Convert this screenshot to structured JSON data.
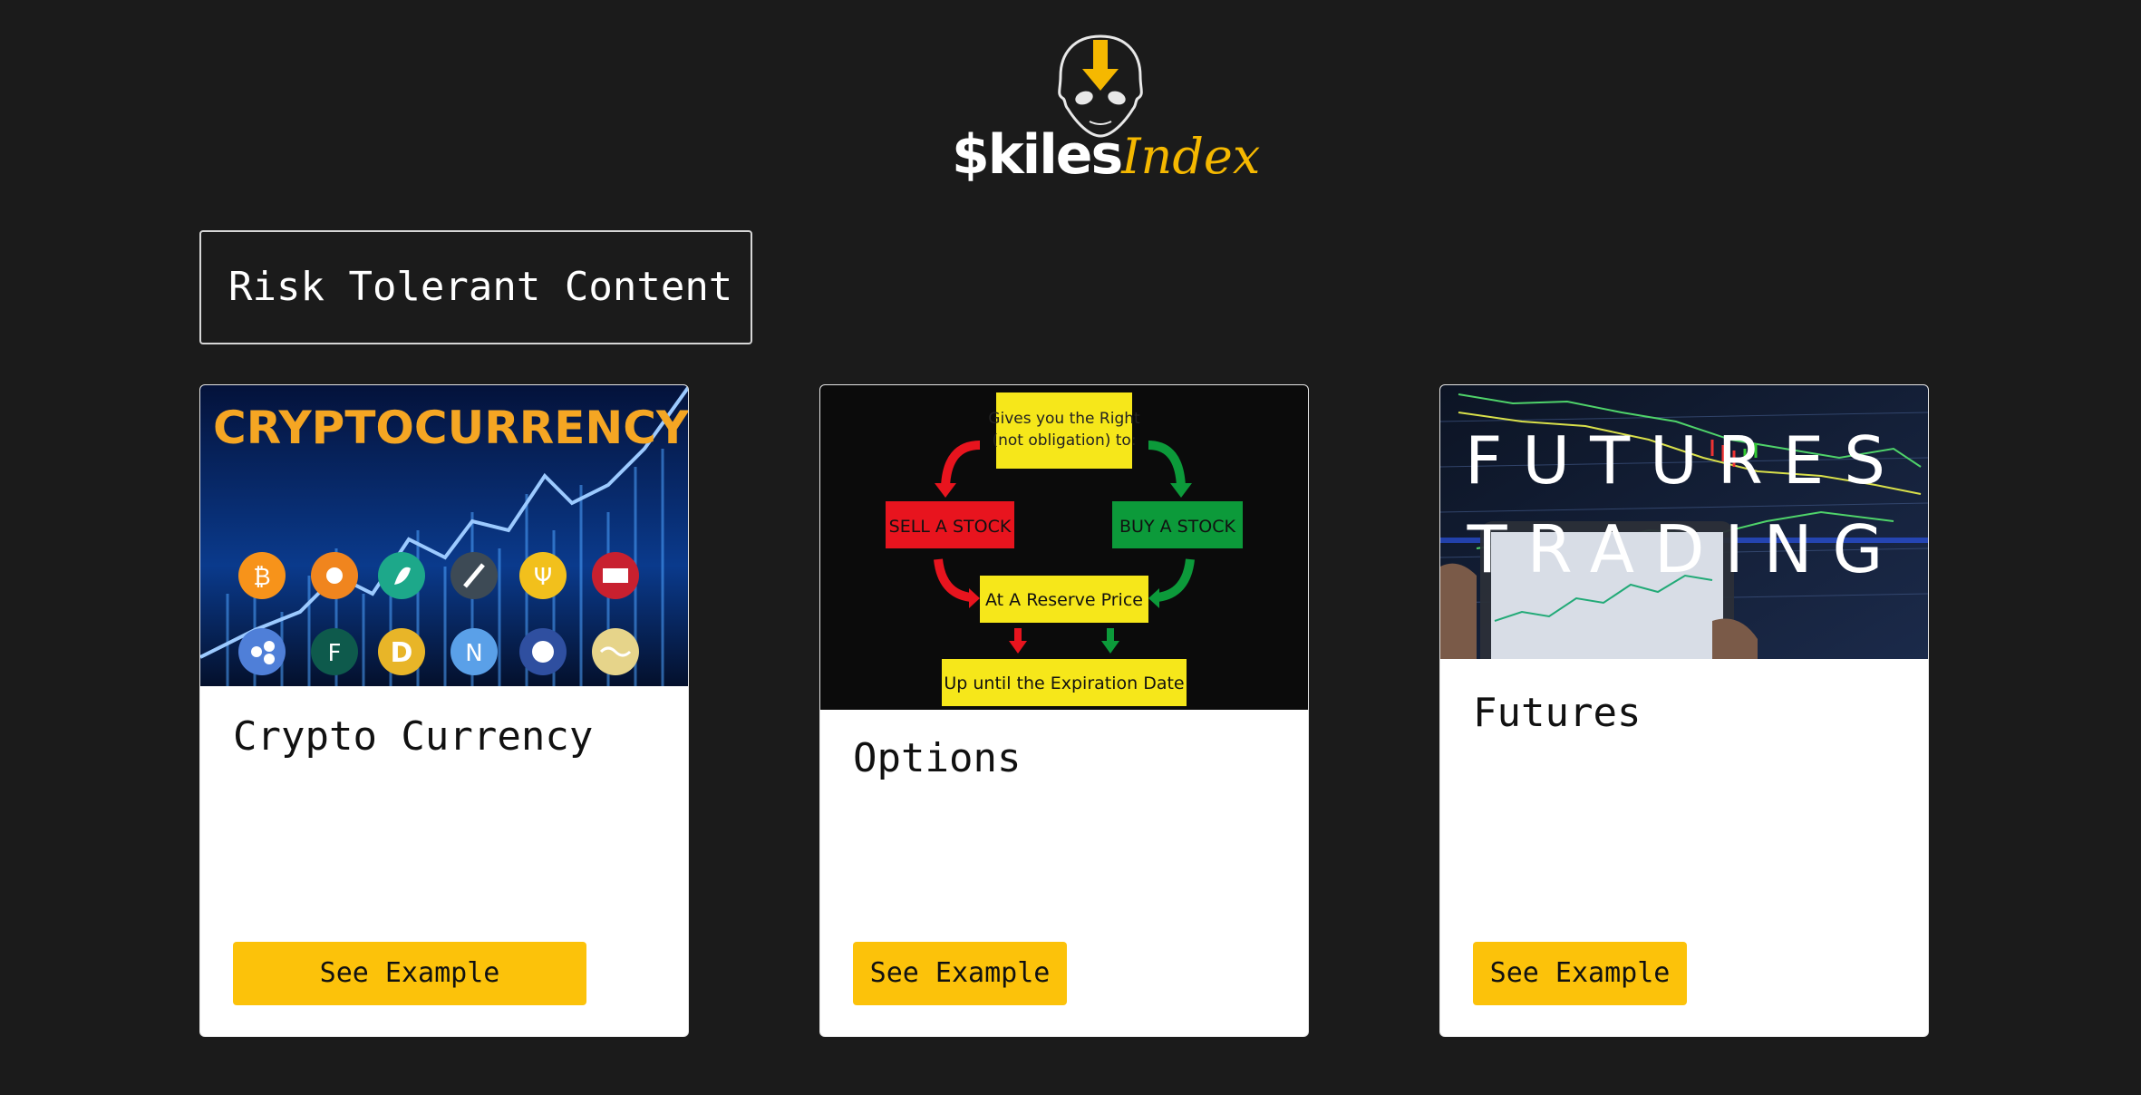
{
  "logo": {
    "brand_main": "$kiles",
    "brand_accent": "Index"
  },
  "section": {
    "heading": "Risk Tolerant Content"
  },
  "cards": [
    {
      "title": "Crypto Currency",
      "button_label": "See Example",
      "image": {
        "banner_text": "CRYPTOCURRENCY"
      }
    },
    {
      "title": "Options",
      "button_label": "See Example",
      "image": {
        "top_text_1": "Gives you the Right",
        "top_text_2": "(not obligation) to:",
        "left_text": "SELL A STOCK",
        "right_text": "BUY A STOCK",
        "middle_text": "At A Reserve Price",
        "bottom_text": "Up until the Expiration Date"
      }
    },
    {
      "title": "Futures",
      "button_label": "See Example",
      "image": {
        "line_1": "FUTURES",
        "line_2": "TRADING"
      }
    }
  ],
  "colors": {
    "background": "#1b1b1b",
    "accent": "#fcc20a",
    "card": "#ffffff"
  }
}
